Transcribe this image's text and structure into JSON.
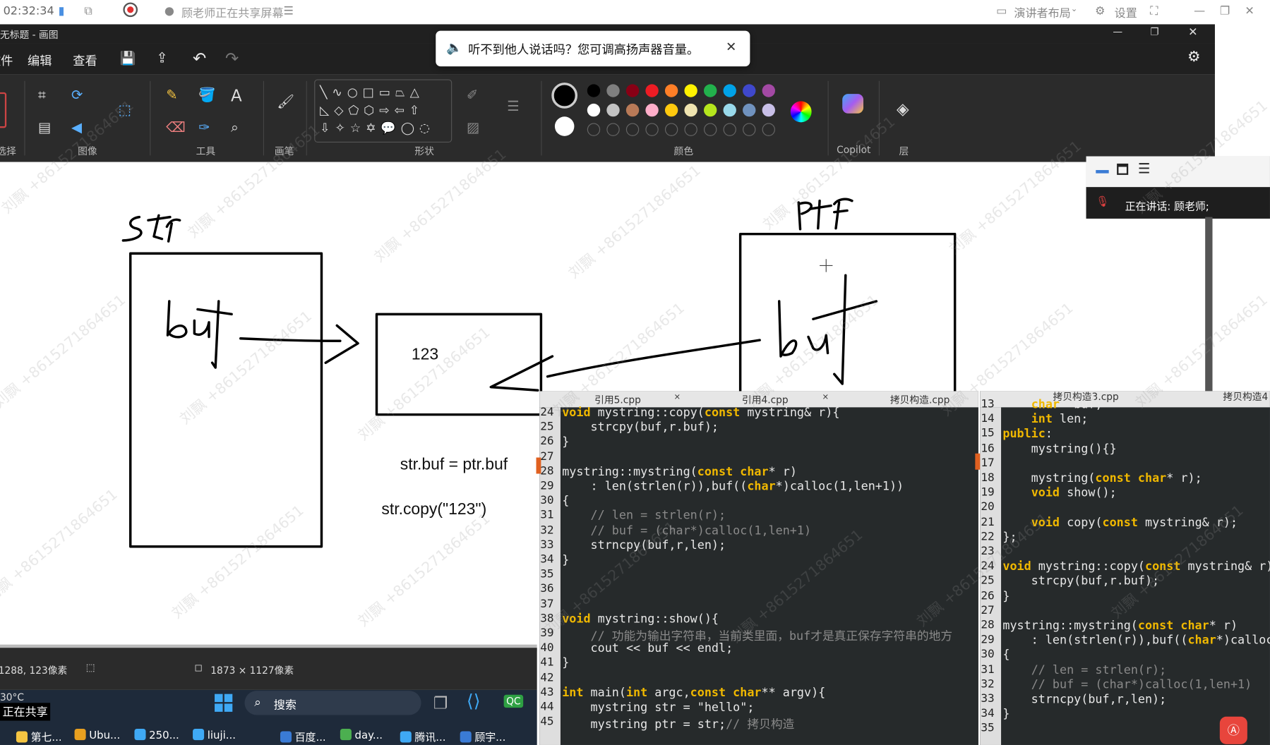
{
  "meeting_bar": {
    "time": "02:32:34",
    "sharing_text": "顾老师正在共享屏幕",
    "layout_label": "演讲者布局",
    "settings_label": "设置"
  },
  "paint": {
    "title": "无标题 - 画图",
    "menu": {
      "file": "文件",
      "edit": "编辑",
      "view": "查看"
    },
    "groups": {
      "select": "选择",
      "image": "图像",
      "tools": "工具",
      "brush": "画笔",
      "shapes": "形状",
      "colors": "颜色",
      "copilot": "Copilot",
      "layers": "层"
    },
    "toast": "听不到他人说话吗？您可调高扬声器音量。",
    "status": {
      "cursor_pos": "1288, 123像素",
      "canvas_size": "1873 × 1127像素"
    },
    "palette_row1": [
      "#000000",
      "#7f7f7f",
      "#880015",
      "#ed1c24",
      "#ff7f27",
      "#fff200",
      "#22b14c",
      "#00a2e8",
      "#3f48cc",
      "#a349a4"
    ],
    "palette_row2": [
      "#ffffff",
      "#c3c3c3",
      "#b97a57",
      "#ffaec9",
      "#ffc90e",
      "#efe4b0",
      "#b5e61d",
      "#99d9ea",
      "#7092be",
      "#c8bfe7"
    ]
  },
  "drawing": {
    "label_str": "str",
    "label_ptr": "ptr",
    "box_value": "123",
    "text_line1": "str.buf = ptr.buf",
    "text_line2": "str.copy(\"123\")",
    "buf_left": "buf",
    "buf_right": "buf"
  },
  "meeting_panel": {
    "speaking": "正在讲话: 顾老师;"
  },
  "taskbar": {
    "weather": "30°C",
    "sharing": "正在共享",
    "search": "搜索",
    "apps": [
      "第七...",
      "Ubu...",
      "250...",
      "liuji...",
      "百度...",
      "day...",
      "腾讯...",
      "顾宇..."
    ]
  },
  "editor_left": {
    "tabs": [
      "引用5.cpp",
      "引用4.cpp",
      "拷贝构造.cpp"
    ],
    "lines": [
      {
        "n": "24",
        "t": "void mystring::copy(const mystring& r){"
      },
      {
        "n": "25",
        "t": "    strcpy(buf,r.buf);"
      },
      {
        "n": "26",
        "t": "}"
      },
      {
        "n": "27",
        "t": ""
      },
      {
        "n": "28",
        "t": "mystring::mystring(const char* r)"
      },
      {
        "n": "29",
        "t": "    : len(strlen(r)),buf((char*)calloc(1,len+1))"
      },
      {
        "n": "30",
        "t": "{"
      },
      {
        "n": "31",
        "t": "    // len = strlen(r);"
      },
      {
        "n": "32",
        "t": "    // buf = (char*)calloc(1,len+1)"
      },
      {
        "n": "33",
        "t": "    strncpy(buf,r,len);"
      },
      {
        "n": "34",
        "t": "}"
      },
      {
        "n": "35",
        "t": ""
      },
      {
        "n": "36",
        "t": ""
      },
      {
        "n": "37",
        "t": ""
      },
      {
        "n": "38",
        "t": "void mystring::show(){"
      },
      {
        "n": "39",
        "t": "    // 功能为输出字符串，当前类里面，buf才是真正保存字符串的地方"
      },
      {
        "n": "40",
        "t": "    cout << buf << endl;"
      },
      {
        "n": "41",
        "t": "}"
      },
      {
        "n": "42",
        "t": ""
      },
      {
        "n": "43",
        "t": "int main(int argc,const char** argv){"
      },
      {
        "n": "44",
        "t": "    mystring str = \"hello\";"
      },
      {
        "n": "45",
        "t": "    mystring ptr = str;// 拷贝构造"
      }
    ]
  },
  "editor_right": {
    "tabs": [
      "拷贝构造3.cpp",
      "拷贝构造4"
    ],
    "lines": [
      {
        "n": "13",
        "t": "    char* buf;"
      },
      {
        "n": "14",
        "t": "    int len;"
      },
      {
        "n": "15",
        "t": "public:"
      },
      {
        "n": "16",
        "t": "    mystring(){}"
      },
      {
        "n": "17",
        "t": ""
      },
      {
        "n": "18",
        "t": "    mystring(const char* r);"
      },
      {
        "n": "19",
        "t": "    void show();"
      },
      {
        "n": "20",
        "t": ""
      },
      {
        "n": "21",
        "t": "    void copy(const mystring& r);"
      },
      {
        "n": "22",
        "t": "};"
      },
      {
        "n": "23",
        "t": ""
      },
      {
        "n": "24",
        "t": "void mystring::copy(const mystring& r)"
      },
      {
        "n": "25",
        "t": "    strcpy(buf,r.buf);"
      },
      {
        "n": "26",
        "t": "}"
      },
      {
        "n": "27",
        "t": ""
      },
      {
        "n": "28",
        "t": "mystring::mystring(const char* r)"
      },
      {
        "n": "29",
        "t": "    : len(strlen(r)),buf((char*)calloc"
      },
      {
        "n": "30",
        "t": "{"
      },
      {
        "n": "31",
        "t": "    // len = strlen(r);"
      },
      {
        "n": "32",
        "t": "    // buf = (char*)calloc(1,len+1)"
      },
      {
        "n": "33",
        "t": "    strncpy(buf,r,len);"
      },
      {
        "n": "34",
        "t": "}"
      },
      {
        "n": "35",
        "t": ""
      }
    ]
  },
  "watermark": "刘飘 +8615271864651"
}
